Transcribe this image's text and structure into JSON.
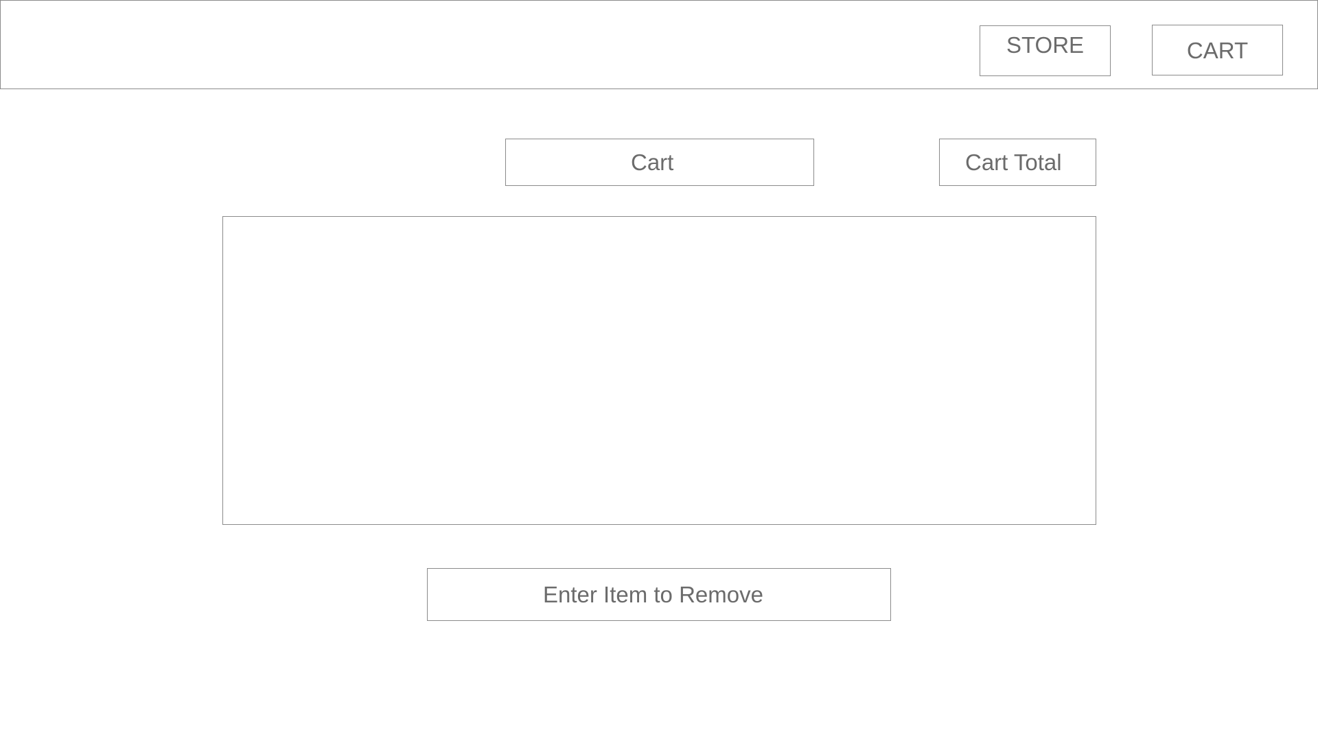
{
  "header": {
    "nav": {
      "store_label": "STORE",
      "cart_label": "CART"
    }
  },
  "main": {
    "cart_title": "Cart",
    "cart_total_label": "Cart Total",
    "remove_input": {
      "value": "",
      "placeholder": "Enter Item to Remove"
    }
  },
  "colors": {
    "border": "#8a8a8a",
    "text": "#6b6b6b",
    "background": "#ffffff"
  }
}
